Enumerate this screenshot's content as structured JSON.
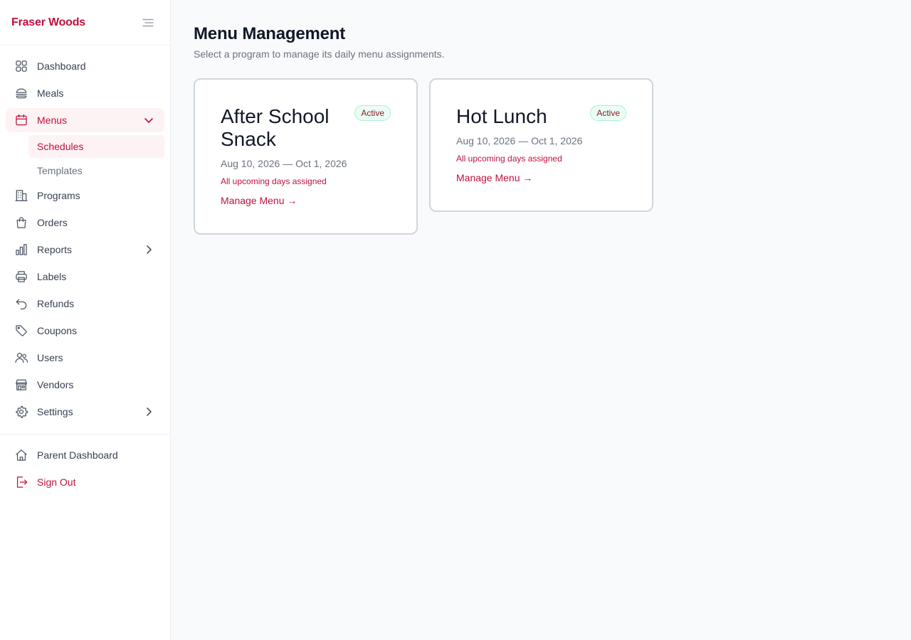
{
  "brand": {
    "name": "Fraser Woods"
  },
  "sidebar": {
    "items": [
      {
        "key": "dashboard",
        "label": "Dashboard",
        "icon": "grid-icon"
      },
      {
        "key": "meals",
        "label": "Meals",
        "icon": "burger-icon"
      },
      {
        "key": "menus",
        "label": "Menus",
        "icon": "calendar-icon",
        "expanded": true,
        "children": [
          {
            "label": "Schedules",
            "active": true
          },
          {
            "label": "Templates"
          }
        ]
      },
      {
        "key": "programs",
        "label": "Programs",
        "icon": "building-icon"
      },
      {
        "key": "orders",
        "label": "Orders",
        "icon": "shopping-bag-icon"
      },
      {
        "key": "reports",
        "label": "Reports",
        "icon": "bar-chart-icon",
        "has_submenu": true
      },
      {
        "key": "labels",
        "label": "Labels",
        "icon": "printer-icon"
      },
      {
        "key": "refunds",
        "label": "Refunds",
        "icon": "undo-arrow-icon"
      },
      {
        "key": "coupons",
        "label": "Coupons",
        "icon": "tag-icon"
      },
      {
        "key": "users",
        "label": "Users",
        "icon": "users-icon"
      },
      {
        "key": "vendors",
        "label": "Vendors",
        "icon": "storefront-icon"
      },
      {
        "key": "settings",
        "label": "Settings",
        "icon": "gear-icon",
        "has_submenu": true
      }
    ],
    "bottom": [
      {
        "key": "parent-dashboard",
        "label": "Parent Dashboard",
        "icon": "home-icon"
      },
      {
        "key": "sign-out",
        "label": "Sign Out",
        "icon": "sign-out-icon"
      }
    ]
  },
  "main": {
    "title": "Menu Management",
    "subtitle": "Select a program to manage its daily menu assignments.",
    "cards": [
      {
        "title": "After School Snack",
        "badge": "Active",
        "dates": "Aug 10, 2026 — Oct 1, 2026",
        "status": "All upcoming days assigned",
        "link": "Manage Menu →"
      },
      {
        "title": "Hot Lunch",
        "badge": "Active",
        "dates": "Aug 10, 2026 — Oct 1, 2026",
        "status": "All upcoming days assigned",
        "link": "Manage Menu →"
      }
    ]
  },
  "colors": {
    "accent": "#be123c",
    "active_bg": "#fdf2f4",
    "badge_bg": "#ecfdf5",
    "badge_border": "#a7f3d0"
  }
}
